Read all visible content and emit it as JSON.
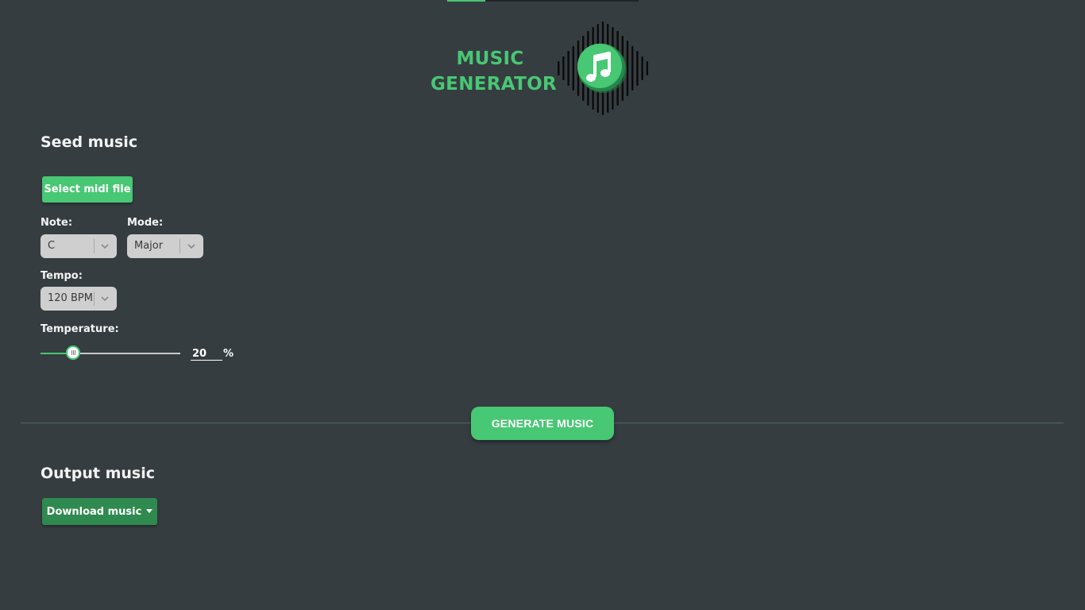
{
  "app": {
    "title_line1": "MUSIC",
    "title_line2": "GENERATOR",
    "logo_icon": "music-note-icon",
    "progress_fraction": 0.2
  },
  "seed": {
    "title": "Seed music",
    "select_file_label": "Select midi file",
    "note_label": "Note:",
    "note_value": "C",
    "mode_label": "Mode:",
    "mode_value": "Major",
    "tempo_label": "Tempo:",
    "tempo_value": "120 BPM",
    "temperature_label": "Temperature:",
    "temperature_value": "20",
    "temperature_unit": "%"
  },
  "generate": {
    "label": "GENERATE MUSIC"
  },
  "output": {
    "title": "Output music",
    "download_label": "Download music"
  },
  "colors": {
    "accent": "#48c774",
    "accent_dark": "#2e8a4e",
    "background": "#363d41"
  }
}
